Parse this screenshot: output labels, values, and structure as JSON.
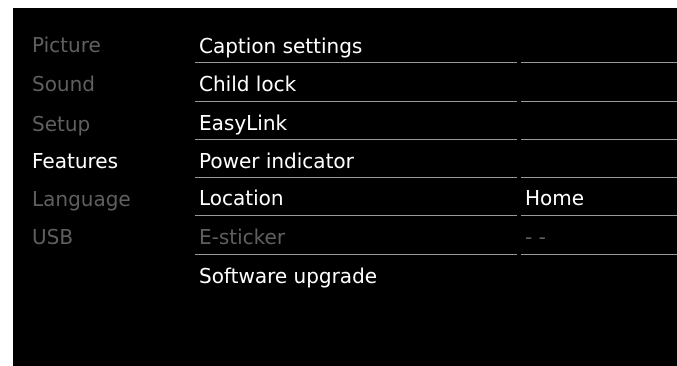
{
  "menu": {
    "categories": [
      {
        "label": "Picture",
        "active": false
      },
      {
        "label": "Sound",
        "active": false
      },
      {
        "label": "Setup",
        "active": false
      },
      {
        "label": "Features",
        "active": true
      },
      {
        "label": "Language",
        "active": false
      },
      {
        "label": "USB",
        "active": false
      }
    ],
    "options": [
      {
        "label": "Caption settings",
        "value": "",
        "enabled": true
      },
      {
        "label": "Child lock",
        "value": "",
        "enabled": true
      },
      {
        "label": "EasyLink",
        "value": "",
        "enabled": true
      },
      {
        "label": "Power indicator",
        "value": "",
        "enabled": true
      },
      {
        "label": "Location",
        "value": "Home",
        "enabled": true
      },
      {
        "label": "E-sticker",
        "value": "- -",
        "enabled": false
      },
      {
        "label": "Software upgrade",
        "value": "",
        "enabled": true
      }
    ]
  },
  "colors": {
    "background": "#000000",
    "active_text": "#ffffff",
    "inactive_text": "#5f5f5f",
    "divider": "#9a9a9a"
  }
}
